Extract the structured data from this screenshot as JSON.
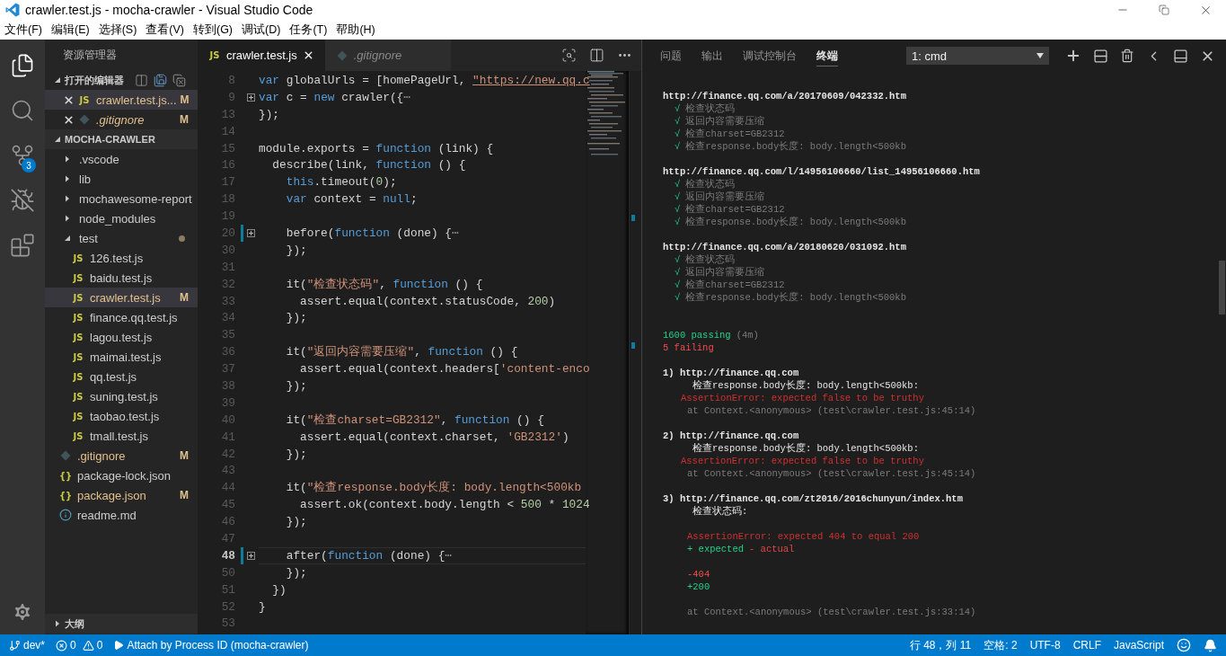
{
  "window": {
    "title": "crawler.test.js - mocha-crawler - Visual Studio Code"
  },
  "menu": [
    "文件(F)",
    "编辑(E)",
    "选择(S)",
    "查看(V)",
    "转到(G)",
    "调试(D)",
    "任务(T)",
    "帮助(H)"
  ],
  "activity_bar": [
    {
      "kind": "files",
      "selected": true
    },
    {
      "kind": "search",
      "selected": false
    },
    {
      "kind": "git",
      "selected": false,
      "badge": "3"
    },
    {
      "kind": "debug",
      "selected": false
    },
    {
      "kind": "extensions",
      "selected": false
    }
  ],
  "sidebar": {
    "title": "资源管理器",
    "open_editors": {
      "title": "打开的编辑器",
      "expanded": true,
      "items": [
        {
          "name": "crawler.test.js...",
          "kind": "js",
          "icon_text": "JS",
          "modified": true,
          "status": "M",
          "selected": true,
          "preview": false
        },
        {
          "name": ".gitignore",
          "kind": "git",
          "modified": true,
          "status": "M",
          "selected": false,
          "preview": true
        }
      ]
    },
    "project": {
      "name": "MOCHA-CRAWLER",
      "expanded": true,
      "children": [
        {
          "name": ".vscode",
          "kind": "folder",
          "expanded": false,
          "selected": false,
          "modified": false
        },
        {
          "name": "lib",
          "kind": "folder",
          "expanded": false,
          "selected": false,
          "modified": false
        },
        {
          "name": "mochawesome-report",
          "kind": "folder",
          "expanded": false,
          "selected": false,
          "modified": false
        },
        {
          "name": "node_modules",
          "kind": "folder",
          "expanded": false,
          "selected": false,
          "modified": false
        },
        {
          "name": "test",
          "kind": "folder",
          "expanded": true,
          "selected": false,
          "modified": true,
          "children": [
            {
              "name": "126.test.js",
              "kind": "js",
              "icon_text": "JS",
              "selected": false,
              "modified": false
            },
            {
              "name": "baidu.test.js",
              "kind": "js",
              "icon_text": "JS",
              "selected": false,
              "modified": false
            },
            {
              "name": "crawler.test.js",
              "kind": "js",
              "icon_text": "JS",
              "selected": true,
              "modified": true,
              "status": "M"
            },
            {
              "name": "finance.qq.test.js",
              "kind": "js",
              "icon_text": "JS",
              "selected": false,
              "modified": false
            },
            {
              "name": "lagou.test.js",
              "kind": "js",
              "icon_text": "JS",
              "selected": false,
              "modified": false
            },
            {
              "name": "maimai.test.js",
              "kind": "js",
              "icon_text": "JS",
              "selected": false,
              "modified": false
            },
            {
              "name": "qq.test.js",
              "kind": "js",
              "icon_text": "JS",
              "selected": false,
              "modified": false
            },
            {
              "name": "suning.test.js",
              "kind": "js",
              "icon_text": "JS",
              "selected": false,
              "modified": false
            },
            {
              "name": "taobao.test.js",
              "kind": "js",
              "icon_text": "JS",
              "selected": false,
              "modified": false
            },
            {
              "name": "tmall.test.js",
              "kind": "js",
              "icon_text": "JS",
              "selected": false,
              "modified": false
            }
          ]
        },
        {
          "name": ".gitignore",
          "kind": "git",
          "selected": false,
          "modified": true,
          "status": "M"
        },
        {
          "name": "package-lock.json",
          "kind": "json",
          "icon_text": "{}",
          "selected": false,
          "modified": false
        },
        {
          "name": "package.json",
          "kind": "json",
          "icon_text": "{}",
          "selected": false,
          "modified": true,
          "status": "M"
        },
        {
          "name": "readme.md",
          "kind": "info",
          "selected": false,
          "modified": false
        }
      ]
    },
    "outline": {
      "title": "大纲",
      "expanded": false
    }
  },
  "editor": {
    "tabs": [
      {
        "label": "crawler.test.js",
        "kind": "js",
        "icon_text": "JS",
        "selected": true,
        "preview": false
      },
      {
        "label": ".gitignore",
        "kind": "git",
        "selected": false,
        "preview": true
      }
    ],
    "lines": [
      {
        "number": "8",
        "tokens": [
          {
            "kind": "k",
            "text": "var"
          },
          {
            "kind": "p",
            "text": " globalUrls = [homePageUrl, "
          },
          {
            "kind": "u",
            "text": "\"https://new.qq.c"
          }
        ]
      },
      {
        "number": "9",
        "fold": true,
        "tokens": [
          {
            "kind": "k",
            "text": "var"
          },
          {
            "kind": "p",
            "text": " c = "
          },
          {
            "kind": "k",
            "text": "new"
          },
          {
            "kind": "p",
            "text": " crawler({"
          },
          {
            "kind": "e",
            "text": "⋯"
          }
        ]
      },
      {
        "number": "13",
        "tokens": [
          {
            "kind": "p",
            "text": "});"
          }
        ]
      },
      {
        "number": "14"
      },
      {
        "number": "15",
        "tokens": [
          {
            "kind": "p",
            "text": "module.exports = "
          },
          {
            "kind": "k",
            "text": "function"
          },
          {
            "kind": "p",
            "text": " (link) {"
          }
        ]
      },
      {
        "number": "16",
        "tokens": [
          {
            "kind": "p",
            "text": "  describe(link, "
          },
          {
            "kind": "k",
            "text": "function"
          },
          {
            "kind": "p",
            "text": " () {"
          }
        ]
      },
      {
        "number": "17",
        "tokens": [
          {
            "kind": "k",
            "text": "    this"
          },
          {
            "kind": "p",
            "text": ".timeout("
          },
          {
            "kind": "n",
            "text": "0"
          },
          {
            "kind": "p",
            "text": ");"
          }
        ]
      },
      {
        "number": "18",
        "tokens": [
          {
            "kind": "k",
            "text": "    var"
          },
          {
            "kind": "p",
            "text": " context = "
          },
          {
            "kind": "k",
            "text": "null"
          },
          {
            "kind": "p",
            "text": ";"
          }
        ]
      },
      {
        "number": "19"
      },
      {
        "number": "20",
        "fold": true,
        "changed": true,
        "tokens": [
          {
            "kind": "p",
            "text": "    before("
          },
          {
            "kind": "k",
            "text": "function"
          },
          {
            "kind": "p",
            "text": " (done) {"
          },
          {
            "kind": "e",
            "text": "⋯"
          }
        ]
      },
      {
        "number": "30",
        "tokens": [
          {
            "kind": "p",
            "text": "    });"
          }
        ]
      },
      {
        "number": "31"
      },
      {
        "number": "32",
        "tokens": [
          {
            "kind": "p",
            "text": "    it("
          },
          {
            "kind": "s",
            "text": "\"检查状态码\""
          },
          {
            "kind": "p",
            "text": ", "
          },
          {
            "kind": "k",
            "text": "function"
          },
          {
            "kind": "p",
            "text": " () {"
          }
        ]
      },
      {
        "number": "33",
        "tokens": [
          {
            "kind": "p",
            "text": "      assert.equal(context.statusCode, "
          },
          {
            "kind": "n",
            "text": "200"
          },
          {
            "kind": "p",
            "text": ")"
          }
        ]
      },
      {
        "number": "34",
        "tokens": [
          {
            "kind": "p",
            "text": "    });"
          }
        ]
      },
      {
        "number": "35"
      },
      {
        "number": "36",
        "tokens": [
          {
            "kind": "p",
            "text": "    it("
          },
          {
            "kind": "s",
            "text": "\"返回内容需要压缩\""
          },
          {
            "kind": "p",
            "text": ", "
          },
          {
            "kind": "k",
            "text": "function"
          },
          {
            "kind": "p",
            "text": " () {"
          }
        ]
      },
      {
        "number": "37",
        "tokens": [
          {
            "kind": "p",
            "text": "      assert.equal(context.headers["
          },
          {
            "kind": "s",
            "text": "'content-enco"
          }
        ]
      },
      {
        "number": "38",
        "tokens": [
          {
            "kind": "p",
            "text": "    });"
          }
        ]
      },
      {
        "number": "39"
      },
      {
        "number": "40",
        "tokens": [
          {
            "kind": "p",
            "text": "    it("
          },
          {
            "kind": "s",
            "text": "\"检查charset=GB2312\""
          },
          {
            "kind": "p",
            "text": ", "
          },
          {
            "kind": "k",
            "text": "function"
          },
          {
            "kind": "p",
            "text": " () {"
          }
        ]
      },
      {
        "number": "41",
        "tokens": [
          {
            "kind": "p",
            "text": "      assert.equal(context.charset, "
          },
          {
            "kind": "s",
            "text": "'GB2312'"
          },
          {
            "kind": "p",
            "text": ")"
          }
        ]
      },
      {
        "number": "42",
        "tokens": [
          {
            "kind": "p",
            "text": "    });"
          }
        ]
      },
      {
        "number": "43"
      },
      {
        "number": "44",
        "tokens": [
          {
            "kind": "p",
            "text": "    it("
          },
          {
            "kind": "s",
            "text": "\"检查response.body长度: body.length<500kb"
          }
        ]
      },
      {
        "number": "45",
        "tokens": [
          {
            "kind": "p",
            "text": "      assert.ok(context.body.length < "
          },
          {
            "kind": "n",
            "text": "500"
          },
          {
            "kind": "p",
            "text": " * "
          },
          {
            "kind": "n",
            "text": "1024"
          }
        ]
      },
      {
        "number": "46",
        "tokens": [
          {
            "kind": "p",
            "text": "    });"
          }
        ]
      },
      {
        "number": "47"
      },
      {
        "number": "48",
        "fold": true,
        "changed": true,
        "current": true,
        "tokens": [
          {
            "kind": "p",
            "text": "    after("
          },
          {
            "kind": "k",
            "text": "function"
          },
          {
            "kind": "p",
            "text": " (done) {"
          },
          {
            "kind": "e",
            "text": "⋯"
          }
        ]
      },
      {
        "number": "50",
        "tokens": [
          {
            "kind": "p",
            "text": "    });"
          }
        ]
      },
      {
        "number": "51",
        "tokens": [
          {
            "kind": "p",
            "text": "  })"
          }
        ]
      },
      {
        "number": "52",
        "tokens": [
          {
            "kind": "p",
            "text": "}"
          }
        ]
      },
      {
        "number": "53"
      }
    ]
  },
  "panel": {
    "tabs": [
      {
        "label": "问题",
        "selected": false
      },
      {
        "label": "输出",
        "selected": false
      },
      {
        "label": "调试控制台",
        "selected": false
      },
      {
        "label": "终端",
        "selected": true
      }
    ],
    "terminal_select": {
      "value": "1: cmd"
    },
    "terminal": [
      {
        "kind": "url",
        "text": "http://finance.qq.com/a/20170609/042332.htm"
      },
      {
        "kind": "pass",
        "mark": "√",
        "text": "检查状态码"
      },
      {
        "kind": "pass",
        "mark": "√",
        "text": "返回内容需要压缩"
      },
      {
        "kind": "pass",
        "mark": "√",
        "text": "检查charset=GB2312"
      },
      {
        "kind": "pass",
        "mark": "√",
        "text": "检查response.body长度: body.length<500kb"
      },
      {
        "kind": "blank"
      },
      {
        "kind": "url",
        "text": "http://finance.qq.com/l/14956106660/list_14956106660.htm"
      },
      {
        "kind": "pass",
        "mark": "√",
        "text": "检查状态码"
      },
      {
        "kind": "pass",
        "mark": "√",
        "text": "返回内容需要压缩"
      },
      {
        "kind": "pass",
        "mark": "√",
        "text": "检查charset=GB2312"
      },
      {
        "kind": "pass",
        "mark": "√",
        "text": "检查response.body长度: body.length<500kb"
      },
      {
        "kind": "blank"
      },
      {
        "kind": "url",
        "text": "http://finance.qq.com/a/20180620/031092.htm"
      },
      {
        "kind": "pass",
        "mark": "√",
        "text": "检查状态码"
      },
      {
        "kind": "pass",
        "mark": "√",
        "text": "返回内容需要压缩"
      },
      {
        "kind": "pass",
        "mark": "√",
        "text": "检查charset=GB2312"
      },
      {
        "kind": "pass",
        "mark": "√",
        "text": "检查response.body长度: body.length<500kb"
      },
      {
        "kind": "blank"
      },
      {
        "kind": "blank"
      },
      {
        "kind": "summary",
        "parts": [
          {
            "color": "#23d18b",
            "text": "1600 passing"
          },
          {
            "color": "#7a7a7a",
            "text": "(4m)"
          }
        ]
      },
      {
        "kind": "summary",
        "parts": [
          {
            "color": "#f14c4c",
            "text": "5 failing"
          }
        ]
      },
      {
        "kind": "blank"
      },
      {
        "kind": "fail_title",
        "text": "1) http://finance.qq.com"
      },
      {
        "kind": "fail_test",
        "text": "检查response.body长度: body.length<500kb:"
      },
      {
        "kind": "error",
        "text": "AssertionError: expected false to be truthy"
      },
      {
        "kind": "stack",
        "text": "at Context.<anonymous> (test\\crawler.test.js:45:14)"
      },
      {
        "kind": "blank"
      },
      {
        "kind": "fail_title",
        "text": "2) http://finance.qq.com"
      },
      {
        "kind": "fail_test",
        "text": "检查response.body长度: body.length<500kb:"
      },
      {
        "kind": "error",
        "text": "AssertionError: expected false to be truthy"
      },
      {
        "kind": "stack",
        "text": "at Context.<anonymous> (test\\crawler.test.js:45:14)"
      },
      {
        "kind": "blank"
      },
      {
        "kind": "fail_title",
        "text": "3) http://finance.qq.com/zt2016/2016chunyun/index.htm"
      },
      {
        "kind": "fail_test",
        "text": "检查状态码:"
      },
      {
        "kind": "blank"
      },
      {
        "kind": "assert",
        "text": "AssertionError: expected 404 to equal 200"
      },
      {
        "kind": "diff",
        "parts": [
          {
            "color": "#23d18b",
            "text": "+ expected"
          },
          {
            "color": "#e04848",
            "text": "- actual"
          }
        ]
      },
      {
        "kind": "blank"
      },
      {
        "kind": "minus",
        "text": "-404"
      },
      {
        "kind": "plus",
        "text": "+200"
      },
      {
        "kind": "blank"
      },
      {
        "kind": "stack",
        "text": "at Context.<anonymous> (test\\crawler.test.js:33:14)"
      }
    ]
  },
  "status_bar": {
    "branch": "dev*",
    "errors": "0",
    "warnings": "0",
    "debug": "Attach by Process ID (mocha-crawler)",
    "right": [
      "行 48，列 11",
      "空格: 2",
      "UTF-8",
      "CRLF",
      "JavaScript"
    ]
  }
}
